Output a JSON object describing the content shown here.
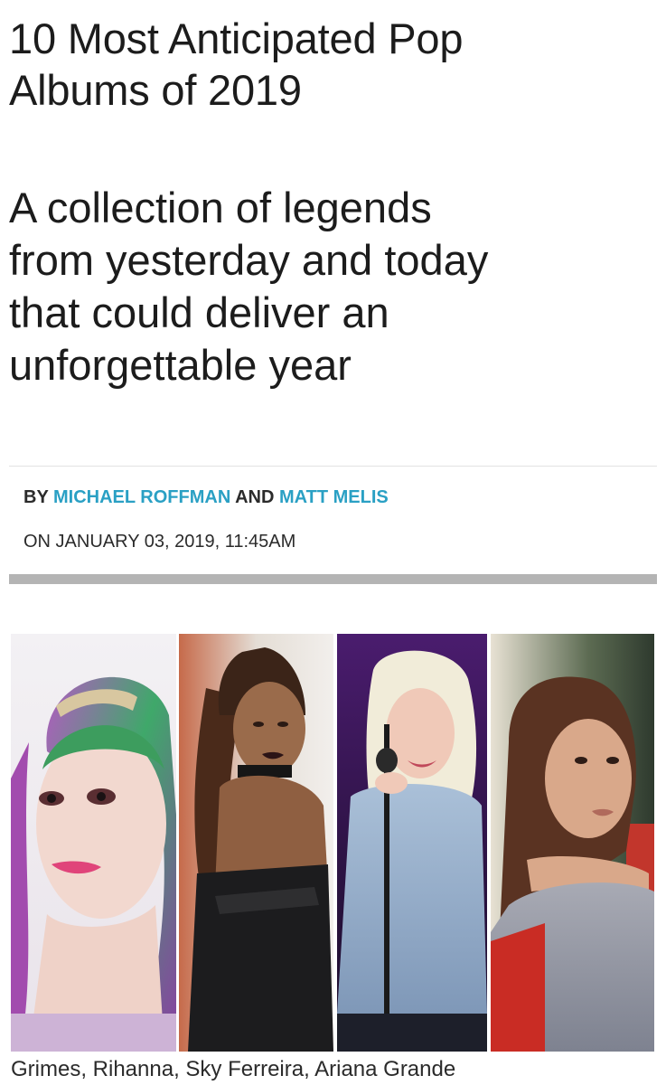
{
  "article": {
    "title_line1": "10 Most Anticipated Pop",
    "title_line2": "Albums of 2019",
    "subtitle_line1": "A collection of legends",
    "subtitle_line2": "from yesterday and today",
    "subtitle_line3": "that could deliver an",
    "subtitle_line4": "unforgettable year"
  },
  "byline": {
    "by": "BY",
    "author1": "MICHAEL ROFFMAN",
    "and": "AND",
    "author2": "MATT MELIS",
    "date": "ON JANUARY 03, 2019, 11:45AM"
  },
  "photo": {
    "caption": "Grimes, Rihanna, Sky Ferreira, Ariana Grande"
  },
  "colors": {
    "author_link": "#2aa0c4",
    "text": "#1c1c1c",
    "thick_rule": "#b4b4b4"
  }
}
